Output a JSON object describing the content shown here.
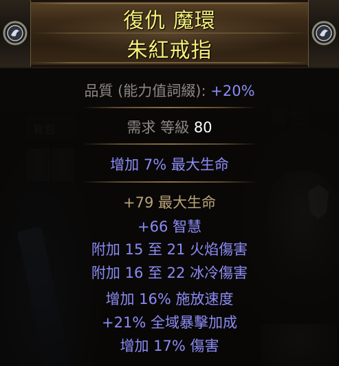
{
  "item": {
    "name": "復仇 魔環",
    "base_type": "朱紅戒指",
    "rarity_color": "#f7f07a"
  },
  "background": {
    "inventory_tab_label": "背包",
    "left_tab_label": "背包"
  },
  "properties": {
    "quality_label": "品質 (能力值詞綴):",
    "quality_value": "+20%",
    "requirement_label": "需求 等級",
    "requirement_value": "80"
  },
  "implicit_mods": [
    "增加 7% 最大生命"
  ],
  "explicit_mods": [
    "+79 最大生命",
    "+66 智慧",
    "附加 15 至 21 火焰傷害",
    "附加 16 至 22 冰冷傷害",
    "增加 16% 施放速度",
    "+21% 全域暴擊加成",
    "增加 17% 傷害"
  ],
  "colors": {
    "title": "#f7f07a",
    "magic_mod": "#8c8cf5",
    "label": "#8c8883",
    "value": "#ffffff",
    "header_frame": "#5b4428"
  },
  "icons": {
    "left_corner": "jeweled-orb-icon",
    "right_corner": "jeweled-orb-icon"
  }
}
